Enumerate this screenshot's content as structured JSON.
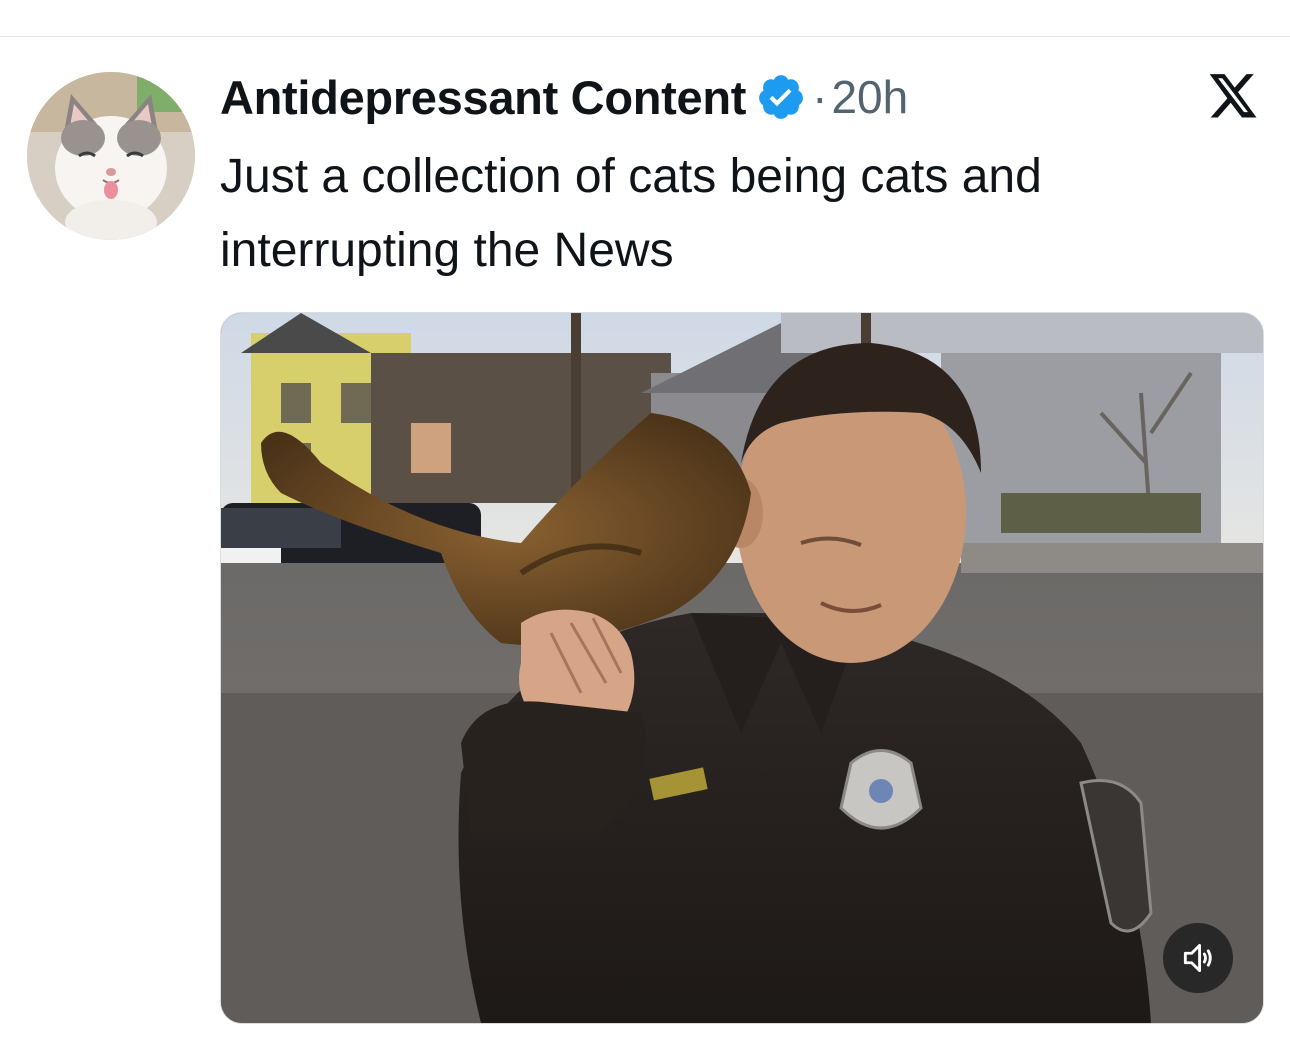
{
  "tweet": {
    "author": {
      "display_name": "Antidepressant Content",
      "verified": true,
      "avatar_icon": "cat-avatar"
    },
    "separator": "·",
    "time_ago": "20h",
    "text": "Just a collection of cats being cats and interrupting the News",
    "media": {
      "type": "video",
      "volume_icon": "speaker-muted-icon"
    }
  },
  "colors": {
    "text_primary": "#0f1419",
    "text_secondary": "#536471",
    "verified_blue": "#1d9bf0",
    "divider": "#e6e6e6"
  }
}
